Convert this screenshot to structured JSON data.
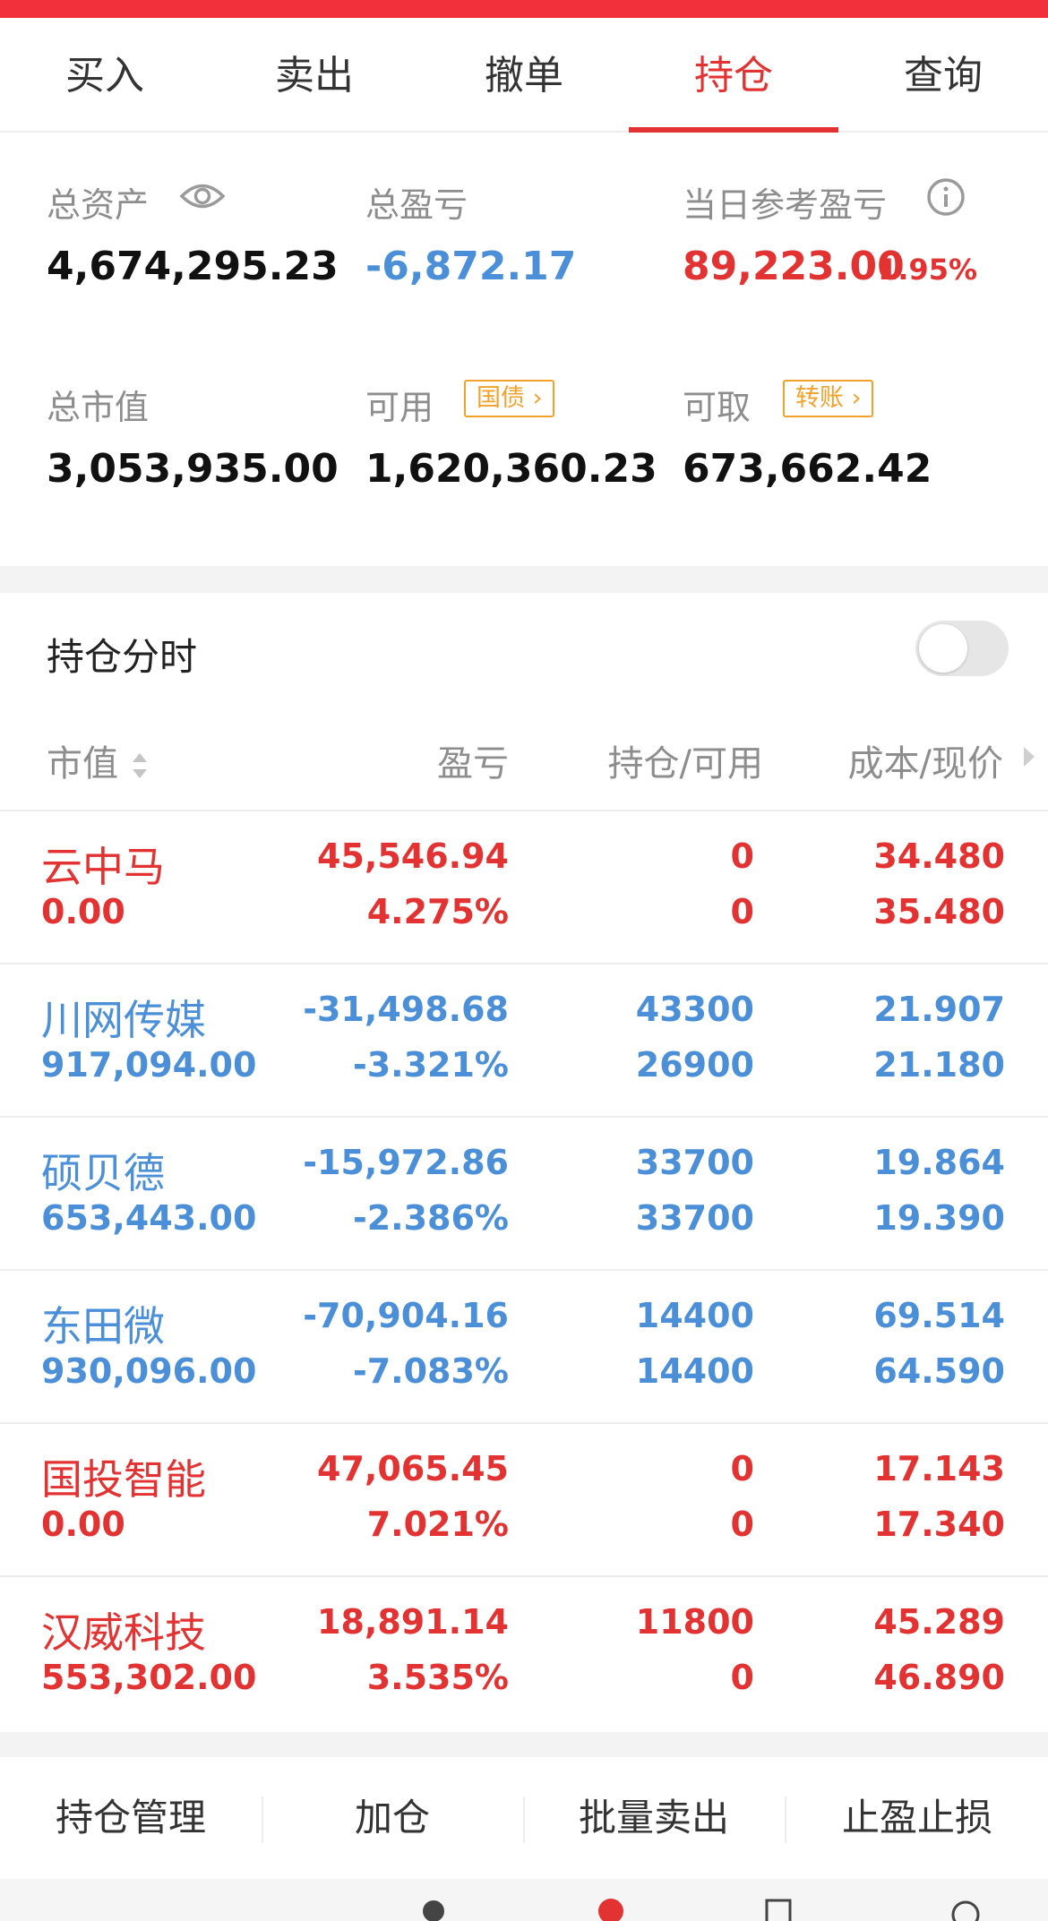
{
  "tabs": [
    {
      "label": "买入"
    },
    {
      "label": "卖出"
    },
    {
      "label": "撤单"
    },
    {
      "label": "持仓"
    },
    {
      "label": "查询"
    }
  ],
  "summary": {
    "total_assets_label": "总资产",
    "total_assets": "4,674,295.23",
    "total_pl_label": "总盈亏",
    "total_pl": "-6,872.17",
    "daily_pl_label": "当日参考盈亏",
    "daily_pl": "89,223.00",
    "daily_pl_pct": "1.95%",
    "market_value_label": "总市值",
    "market_value": "3,053,935.00",
    "available_label": "可用",
    "available": "1,620,360.23",
    "available_tag": "国债",
    "withdrawable_label": "可取",
    "withdrawable": "673,662.42",
    "withdrawable_tag": "转账"
  },
  "holdings_section": {
    "title": "持仓分时",
    "toggle_on": false
  },
  "columns": {
    "market_value": "市值",
    "pl": "盈亏",
    "position": "持仓/可用",
    "cost_price": "成本/现价"
  },
  "rows": [
    {
      "name": "云中马",
      "market_value": "0.00",
      "pl": "45,546.94",
      "pl_pct": "4.275%",
      "position": "0",
      "available": "0",
      "cost": "34.480",
      "price": "35.480",
      "color": "#e33232"
    },
    {
      "name": "川网传媒",
      "market_value": "917,094.00",
      "pl": "-31,498.68",
      "pl_pct": "-3.321%",
      "position": "43300",
      "available": "26900",
      "cost": "21.907",
      "price": "21.180",
      "color": "#4a8fd8"
    },
    {
      "name": "硕贝德",
      "market_value": "653,443.00",
      "pl": "-15,972.86",
      "pl_pct": "-2.386%",
      "position": "33700",
      "available": "33700",
      "cost": "19.864",
      "price": "19.390",
      "color": "#4a8fd8"
    },
    {
      "name": "东田微",
      "market_value": "930,096.00",
      "pl": "-70,904.16",
      "pl_pct": "-7.083%",
      "position": "14400",
      "available": "14400",
      "cost": "69.514",
      "price": "64.590",
      "color": "#4a8fd8"
    },
    {
      "name": "国投智能",
      "market_value": "0.00",
      "pl": "47,065.45",
      "pl_pct": "7.021%",
      "position": "0",
      "available": "0",
      "cost": "17.143",
      "price": "17.340",
      "color": "#e33232"
    },
    {
      "name": "汉威科技",
      "market_value": "553,302.00",
      "pl": "18,891.14",
      "pl_pct": "3.535%",
      "position": "11800",
      "available": "0",
      "cost": "45.289",
      "price": "46.890",
      "color": "#e33232"
    }
  ],
  "actions": [
    {
      "label": "持仓管理"
    },
    {
      "label": "加仓"
    },
    {
      "label": "批量卖出"
    },
    {
      "label": "止盈止损"
    }
  ],
  "colors": {
    "brand_red": "#f2303c",
    "gain": "#e33232",
    "loss": "#4a8fd8",
    "tag_orange": "#f2a12b"
  }
}
